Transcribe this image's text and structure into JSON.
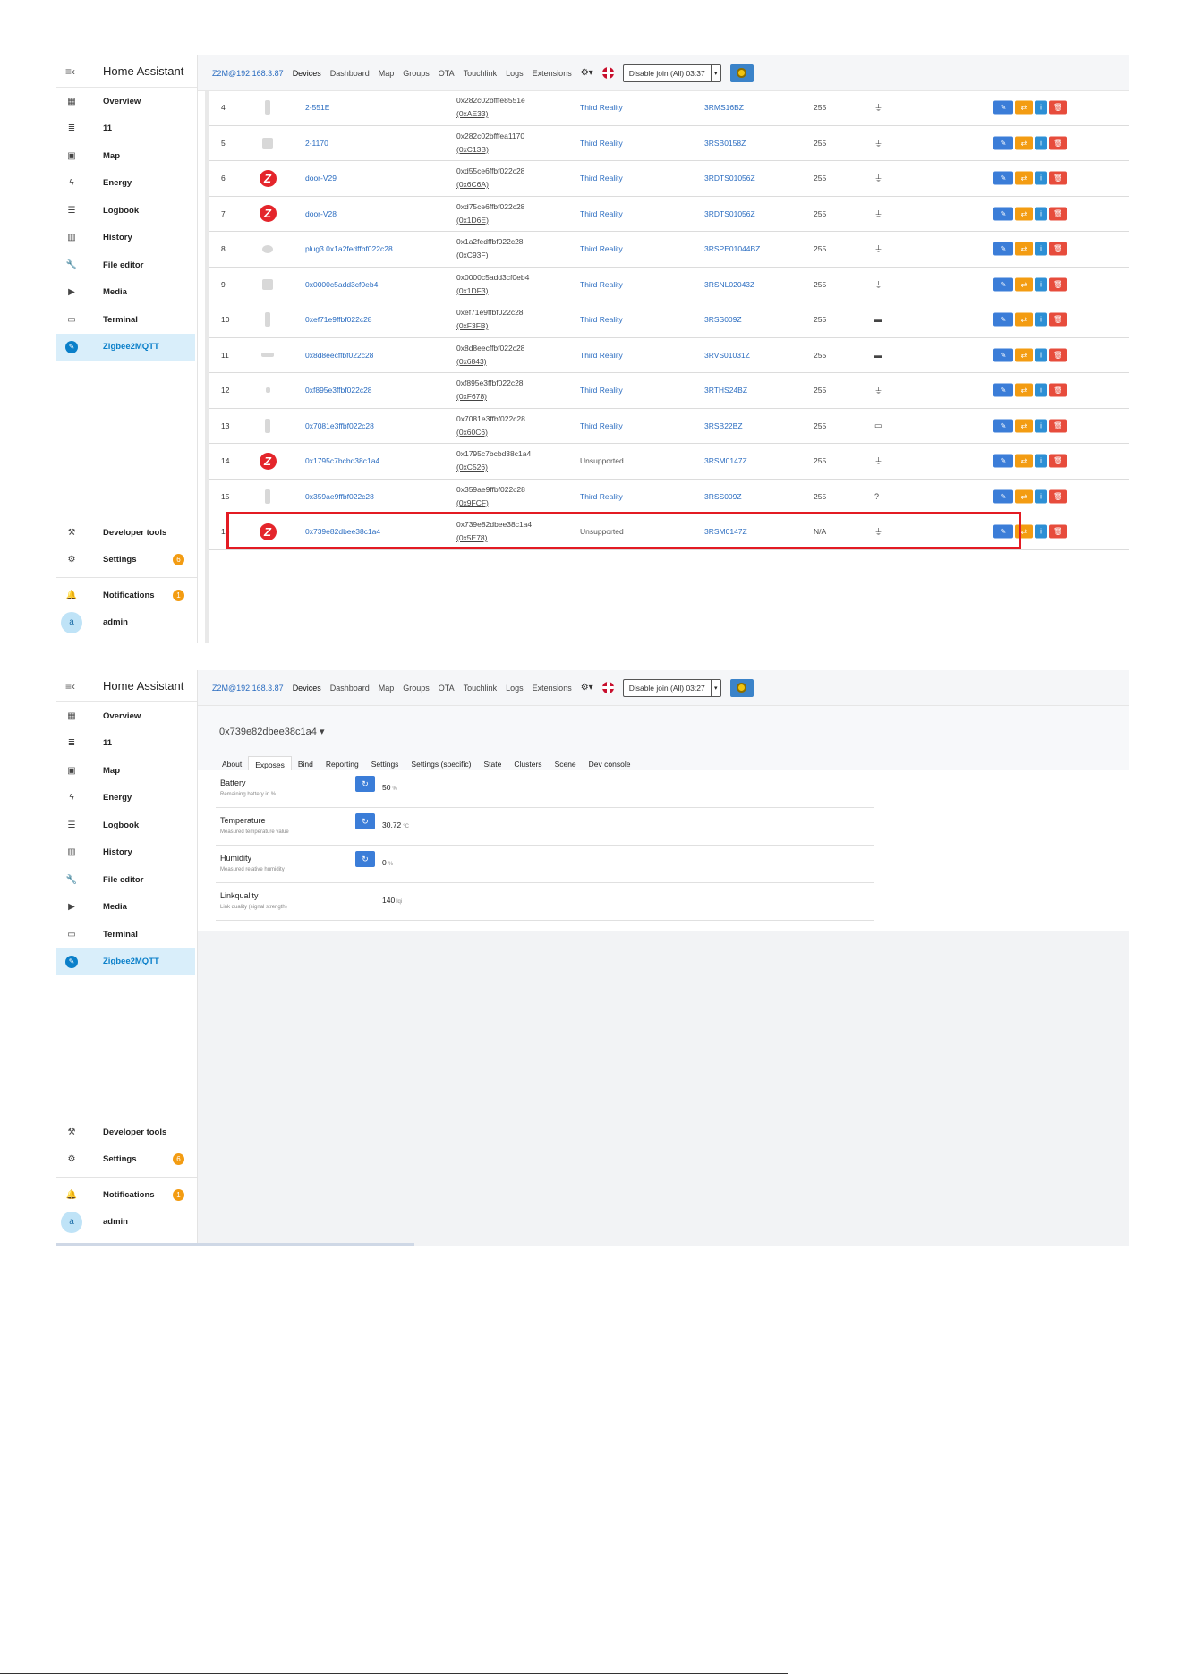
{
  "app_title": "Home Assistant",
  "sidebar": {
    "items": [
      {
        "label": "Overview",
        "icon": "grid-icon",
        "glyph": "▦"
      },
      {
        "label": "11",
        "icon": "list-icon",
        "glyph": "≣"
      },
      {
        "label": "Map",
        "icon": "map-icon",
        "glyph": "▣"
      },
      {
        "label": "Energy",
        "icon": "bolt-icon",
        "glyph": "ϟ"
      },
      {
        "label": "Logbook",
        "icon": "logbook-icon",
        "glyph": "☰"
      },
      {
        "label": "History",
        "icon": "history-icon",
        "glyph": "▥"
      },
      {
        "label": "File editor",
        "icon": "wrench-icon",
        "glyph": "🔧"
      },
      {
        "label": "Media",
        "icon": "media-icon",
        "glyph": "▶"
      },
      {
        "label": "Terminal",
        "icon": "terminal-icon",
        "glyph": "▭"
      },
      {
        "label": "Zigbee2MQTT",
        "icon": "zigbee-icon",
        "glyph": "✎",
        "active": true
      }
    ],
    "developer_tools": "Developer tools",
    "settings": "Settings",
    "settings_badge": "6",
    "notifications": "Notifications",
    "notifications_badge": "1",
    "user": "admin",
    "user_initial": "a"
  },
  "topbar": {
    "brand": "Z2M@192.168.3.87",
    "nav": [
      "Devices",
      "Dashboard",
      "Map",
      "Groups",
      "OTA",
      "Touchlink",
      "Logs",
      "Extensions"
    ],
    "gear": "⚙▾",
    "caret": "▾"
  },
  "screen1": {
    "join_label": "Disable join (All) 03:37",
    "devices": [
      {
        "idx": "4",
        "pic": "thumb-tall",
        "name": "2-551E",
        "ieee": "0x282c02bfffe8551e",
        "nwk": "(0xAE33)",
        "mfr": "Third Reality",
        "model": "3RMS16BZ",
        "lqi": "255",
        "power": "⏚"
      },
      {
        "idx": "5",
        "pic": "thumb-square",
        "name": "2-1170",
        "ieee": "0x282c02bfffea1170",
        "nwk": "(0xC13B)",
        "mfr": "Third Reality",
        "model": "3RSB0158Z",
        "lqi": "255",
        "power": "⏚"
      },
      {
        "idx": "6",
        "pic": "zigbee",
        "name": "door-V29",
        "ieee": "0xd55ce6ffbf022c28",
        "nwk": "(0x6C6A)",
        "mfr": "Third Reality",
        "model": "3RDTS01056Z",
        "lqi": "255",
        "power": "⏚"
      },
      {
        "idx": "7",
        "pic": "zigbee",
        "name": "door-V28",
        "ieee": "0xd75ce6ffbf022c28",
        "nwk": "(0x1D6E)",
        "mfr": "Third Reality",
        "model": "3RDTS01056Z",
        "lqi": "255",
        "power": "⏚"
      },
      {
        "idx": "8",
        "pic": "thumb-round",
        "name": "plug3 0x1a2fedffbf022c28",
        "ieee": "0x1a2fedffbf022c28",
        "nwk": "(0xC93F)",
        "mfr": "Third Reality",
        "model": "3RSPE01044BZ",
        "lqi": "255",
        "power": "⏚"
      },
      {
        "idx": "9",
        "pic": "thumb-square",
        "name": "0x0000c5add3cf0eb4",
        "ieee": "0x0000c5add3cf0eb4",
        "nwk": "(0x1DF3)",
        "mfr": "Third Reality",
        "model": "3RSNL02043Z",
        "lqi": "255",
        "power": "⏚"
      },
      {
        "idx": "10",
        "pic": "thumb-tall",
        "name": "0xef71e9ffbf022c28",
        "ieee": "0xef71e9ffbf022c28",
        "nwk": "(0xF3FB)",
        "mfr": "Third Reality",
        "model": "3RSS009Z",
        "lqi": "255",
        "power": "▬"
      },
      {
        "idx": "11",
        "pic": "thumb-flat",
        "name": "0x8d8eecffbf022c28",
        "ieee": "0x8d8eecffbf022c28",
        "nwk": "(0x6843)",
        "mfr": "Third Reality",
        "model": "3RVS01031Z",
        "lqi": "255",
        "power": "▬"
      },
      {
        "idx": "12",
        "pic": "thumb-small",
        "name": "0xf895e3ffbf022c28",
        "ieee": "0xf895e3ffbf022c28",
        "nwk": "(0xF678)",
        "mfr": "Third Reality",
        "model": "3RTHS24BZ",
        "lqi": "255",
        "power": "⏚"
      },
      {
        "idx": "13",
        "pic": "thumb-tall",
        "name": "0x7081e3ffbf022c28",
        "ieee": "0x7081e3ffbf022c28",
        "nwk": "(0x60C6)",
        "mfr": "Third Reality",
        "model": "3RSB22BZ",
        "lqi": "255",
        "power": "▭"
      },
      {
        "idx": "14",
        "pic": "zigbee",
        "name": "0x1795c7bcbd38c1a4",
        "ieee": "0x1795c7bcbd38c1a4",
        "nwk": "(0xC526)",
        "mfr": "Unsupported",
        "model": "3RSM0147Z",
        "lqi": "255",
        "power": "⏚"
      },
      {
        "idx": "15",
        "pic": "thumb-tall",
        "name": "0x359ae9ffbf022c28",
        "ieee": "0x359ae9ffbf022c28",
        "nwk": "(0x9FCF)",
        "mfr": "Third Reality",
        "model": "3RSS009Z",
        "lqi": "255",
        "power": "?"
      },
      {
        "idx": "16",
        "pic": "zigbee",
        "name": "0x739e82dbee38c1a4",
        "ieee": "0x739e82dbee38c1a4",
        "nwk": "(0x5E78)",
        "mfr": "Unsupported",
        "model": "3RSM0147Z",
        "lqi": "N/A",
        "power": "⏚"
      }
    ],
    "action_icons": {
      "edit": "✎",
      "swap": "⇄",
      "info": "i",
      "delete": "🗑"
    },
    "zigbee_letter": "Z"
  },
  "screen2": {
    "join_label": "Disable join (All) 03:27",
    "device_title": "0x739e82dbee38c1a4 ▾",
    "tabs": [
      "About",
      "Exposes",
      "Bind",
      "Reporting",
      "Settings",
      "Settings (specific)",
      "State",
      "Clusters",
      "Scene",
      "Dev console"
    ],
    "active_tab": "Exposes",
    "exposes": [
      {
        "label": "Battery",
        "desc": "Remaining battery in %",
        "value": "50",
        "unit": "%",
        "refresh": true
      },
      {
        "label": "Temperature",
        "desc": "Measured temperature value",
        "value": "30.72",
        "unit": "°C",
        "refresh": true
      },
      {
        "label": "Humidity",
        "desc": "Measured relative humidity",
        "value": "0",
        "unit": "%",
        "refresh": true
      },
      {
        "label": "Linkquality",
        "desc": "Link quality (signal strength)",
        "value": "140",
        "unit": "lqi",
        "refresh": false
      }
    ],
    "refresh_glyph": "↻"
  }
}
